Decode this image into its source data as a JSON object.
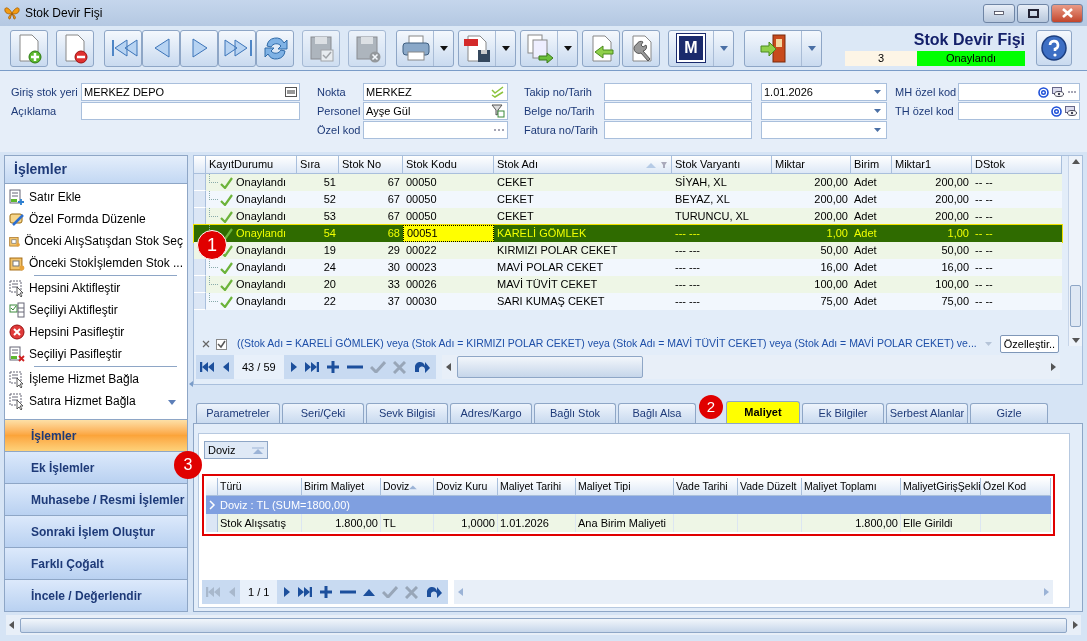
{
  "window": {
    "title": "Stok Devir Fişi"
  },
  "toolbar": [
    {
      "kind": "new",
      "disabled": false,
      "dropdown": false
    },
    {
      "kind": "delete",
      "disabled": false,
      "dropdown": false
    },
    {
      "kind": "first",
      "disabled": false,
      "dropdown": false
    },
    {
      "kind": "prev",
      "disabled": false,
      "dropdown": false
    },
    {
      "kind": "next",
      "disabled": false,
      "dropdown": false
    },
    {
      "kind": "last",
      "disabled": false,
      "dropdown": false
    },
    {
      "kind": "refresh",
      "disabled": false,
      "dropdown": false
    },
    {
      "kind": "save",
      "disabled": true,
      "dropdown": false
    },
    {
      "kind": "cancel",
      "disabled": true,
      "dropdown": false
    },
    {
      "kind": "print",
      "disabled": false,
      "dropdown": true
    },
    {
      "kind": "pdf",
      "disabled": false,
      "dropdown": true
    },
    {
      "kind": "export",
      "disabled": false,
      "dropdown": true
    },
    {
      "kind": "import",
      "disabled": false,
      "dropdown": false
    },
    {
      "kind": "settings",
      "disabled": false,
      "dropdown": false
    },
    {
      "kind": "logo",
      "label": "M",
      "disabled": false,
      "dropdown": true
    },
    {
      "kind": "exit",
      "disabled": false,
      "dropdown": true
    }
  ],
  "header": {
    "title": "Stok Devir Fişi",
    "number": "3",
    "status": "Onaylandı"
  },
  "form": {
    "columns": [
      [
        {
          "label": "Giriş stok yeri",
          "value": "MERKEZ DEPO",
          "kind": "lookup"
        },
        {
          "label": "Açıklama",
          "kind": "text"
        }
      ],
      [
        {
          "label": "Nokta",
          "value": "MERKEZ",
          "kind": "check"
        },
        {
          "label": "Personel",
          "value": "Ayşe Gül",
          "kind": "filter"
        },
        {
          "label": "Özel kod",
          "kind": "ellipsis"
        }
      ],
      [
        {
          "label": "Takip no/Tarih",
          "kind": "pair",
          "date": "1.01.2026"
        },
        {
          "label": "Belge no/Tarih",
          "kind": "pair"
        },
        {
          "label": "Fatura no/Tarih",
          "kind": "pair"
        }
      ],
      [
        {
          "label": "MH özel kod",
          "kind": "code",
          "more": true
        },
        {
          "label": "TH özel kod",
          "kind": "code",
          "more": false
        }
      ]
    ]
  },
  "sidebar": {
    "title": "İşlemler",
    "groups": [
      [
        {
          "label": "Satır Ekle",
          "kind": "add"
        },
        {
          "label": "Özel Formda Düzenle",
          "kind": "edit"
        },
        {
          "label": "Önceki AlışSatışdan Stok Seç",
          "kind": "pick"
        },
        {
          "label": "Önceki Stokİşlemden Stok ...",
          "kind": "pick"
        }
      ],
      [
        {
          "label": "Hepsini Aktifleştir",
          "kind": "select"
        },
        {
          "label": "Seçiliyi Aktifleştir",
          "kind": "toggle"
        },
        {
          "label": "Hepsini Pasifleştir",
          "kind": "remove"
        },
        {
          "label": "Seçiliyi Pasifleştir",
          "kind": "deactivate"
        }
      ],
      [
        {
          "label": "İşleme Hizmet Bağla",
          "kind": "select"
        },
        {
          "label": "Satıra Hizmet Bağla",
          "kind": "select"
        }
      ]
    ],
    "sections": [
      {
        "label": "İşlemler",
        "selected": true
      },
      {
        "label": "Ek İşlemler",
        "selected": false
      },
      {
        "label": "Muhasebe / Resmi İşlemler",
        "selected": false
      },
      {
        "label": "Sonraki İşlem Oluştur",
        "selected": false
      },
      {
        "label": "Farklı Çoğalt",
        "selected": false
      },
      {
        "label": "İncele / Değerlendir",
        "selected": false
      }
    ]
  },
  "grid": {
    "callout": "1",
    "columns": [
      {
        "label": "KayıtDurumu",
        "focused": false,
        "sorted": false
      },
      {
        "label": "Sıra",
        "focused": false,
        "sorted": false
      },
      {
        "label": "Stok No",
        "focused": false,
        "sorted": false
      },
      {
        "label": "Stok Kodu",
        "focused": true,
        "sorted": false
      },
      {
        "label": "Stok Adı",
        "focused": false,
        "sorted": true
      },
      {
        "label": "Stok Varyantı",
        "focused": false,
        "sorted": false
      },
      {
        "label": "Miktar",
        "focused": false,
        "sorted": false
      },
      {
        "label": "Birim",
        "focused": false,
        "sorted": false
      },
      {
        "label": "Miktar1",
        "focused": false,
        "sorted": false
      },
      {
        "label": "DStok",
        "focused": false,
        "sorted": false
      }
    ],
    "rows": [
      {
        "selected": false,
        "cells": [
          "Onaylandı",
          "51",
          "67",
          "00050",
          "CEKET",
          "SİYAH, XL",
          "200,00",
          "Adet",
          "200,00",
          "-- --"
        ]
      },
      {
        "selected": false,
        "cells": [
          "Onaylandı",
          "52",
          "67",
          "00050",
          "CEKET",
          "BEYAZ, XL",
          "200,00",
          "Adet",
          "200,00",
          "-- --"
        ]
      },
      {
        "selected": false,
        "cells": [
          "Onaylandı",
          "53",
          "67",
          "00050",
          "CEKET",
          "TURUNCU, XL",
          "200,00",
          "Adet",
          "200,00",
          "-- --"
        ]
      },
      {
        "selected": true,
        "cells": [
          "Onaylandı",
          "54",
          "68",
          "00051",
          "KARELİ GÖMLEK",
          "--- ---",
          "1,00",
          "Adet",
          "1,00",
          "-- --"
        ]
      },
      {
        "selected": false,
        "cells": [
          "Onaylandı",
          "19",
          "29",
          "00022",
          "KIRMIZI POLAR CEKET",
          "--- ---",
          "50,00",
          "Adet",
          "50,00",
          "-- --"
        ]
      },
      {
        "selected": false,
        "cells": [
          "Onaylandı",
          "24",
          "30",
          "00023",
          "MAVİ POLAR CEKET",
          "--- ---",
          "16,00",
          "Adet",
          "16,00",
          "-- --"
        ]
      },
      {
        "selected": false,
        "cells": [
          "Onaylandı",
          "20",
          "33",
          "00026",
          "MAVİ TÜVİT CEKET",
          "--- ---",
          "100,00",
          "Adet",
          "100,00",
          "-- --"
        ]
      },
      {
        "selected": false,
        "cells": [
          "Onaylandı",
          "22",
          "37",
          "00030",
          "SARI KUMAŞ CEKET",
          "--- ---",
          "75,00",
          "Adet",
          "75,00",
          "-- --"
        ]
      }
    ],
    "filter": {
      "checked": true,
      "text": "((Stok Adı = KARELİ GÖMLEK) veya (Stok Adı = KIRMIZI POLAR CEKET) veya (Stok Adı = MAVİ TÜVİT CEKET) veya (Stok Adı = MAVİ POLAR CEKET) ve...",
      "button": "Özelleştir.."
    },
    "pager": "43 / 59"
  },
  "tabs": {
    "callout": "2",
    "items": [
      {
        "label": "Parametreler",
        "selected": false
      },
      {
        "label": "Seri/Çeki",
        "selected": false
      },
      {
        "label": "Sevk Bilgisi",
        "selected": false
      },
      {
        "label": "Adres/Kargo",
        "selected": false
      },
      {
        "label": "Bağlı Stok",
        "selected": false
      },
      {
        "label": "Bağlı Alsa",
        "selected": false
      },
      {
        "label": "Maliyet",
        "selected": true
      },
      {
        "label": "Ek Bilgiler",
        "selected": false
      },
      {
        "label": "Serbest Alanlar",
        "selected": false
      },
      {
        "label": "Gizle",
        "selected": false
      }
    ]
  },
  "cost": {
    "callout": "3",
    "group_by": "Doviz",
    "columns": [
      "Türü",
      "Birim Maliyet",
      "Doviz",
      "Doviz Kuru",
      "Maliyet Tarihi",
      "Maliyet Tipi",
      "Vade Tarihi",
      "Vade Düzelt",
      "Maliyet Toplamı",
      "MaliyetGirişŞekli",
      "Özel Kod"
    ],
    "group_row": "Doviz : TL (SUM=1800,00)",
    "rows": [
      {
        "cells": [
          "Stok Alışsatış",
          "1.800,00",
          "TL",
          "1,0000",
          "1.01.2026",
          "Ana Birim Maliyeti",
          "",
          "",
          "1.800,00",
          "Elle Girildi",
          ""
        ]
      }
    ],
    "pager": "1 / 1"
  }
}
